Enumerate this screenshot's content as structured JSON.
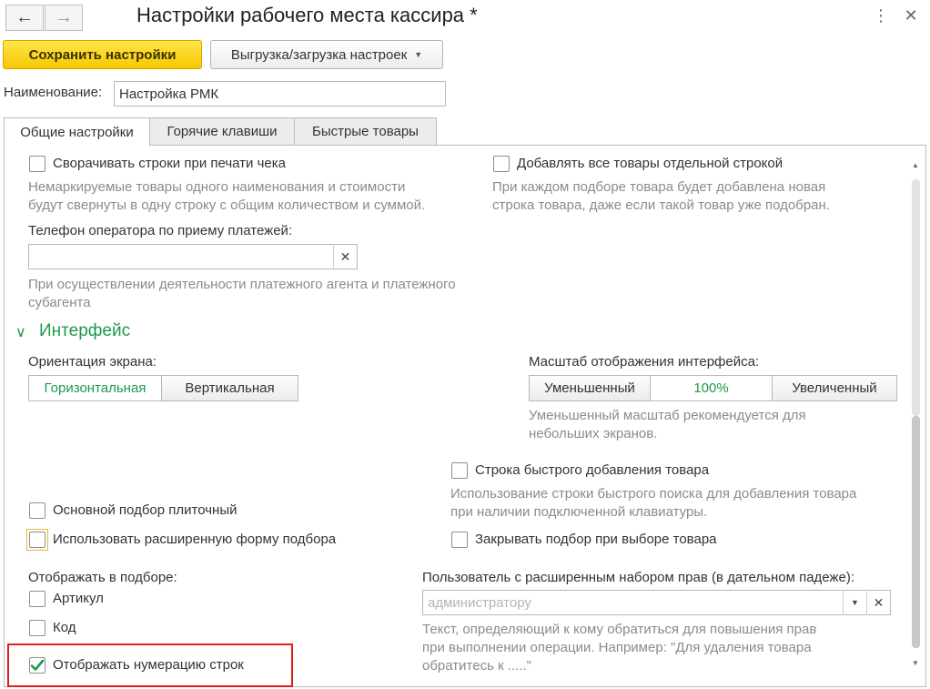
{
  "window": {
    "title": "Настройки рабочего места кассира *",
    "back_icon": "arrow-left-icon",
    "forward_icon": "arrow-right-icon",
    "more_icon": "vertical-dots-icon",
    "close_icon": "close-icon"
  },
  "toolbar": {
    "save_label": "Сохранить настройки",
    "export_label": "Выгрузка/загрузка настроек"
  },
  "name_field": {
    "label": "Наименование:",
    "value": "Настройка РМК"
  },
  "tabs": [
    {
      "label": "Общие настройки",
      "active": true
    },
    {
      "label": "Горячие клавиши",
      "active": false
    },
    {
      "label": "Быстрые товары",
      "active": false
    }
  ],
  "general": {
    "collapse_rows": {
      "label": "Сворачивать строки при печати чека",
      "checked": false,
      "hint_line1": "Немаркируемые товары одного наименования и стоимости",
      "hint_line2": "будут свернуты в одну строку с общим количеством и суммой."
    },
    "separate_row": {
      "label": "Добавлять все товары отдельной строкой",
      "checked": false,
      "hint_line1": "При каждом подборе товара будет добавлена новая",
      "hint_line2": "строка товара, даже если такой товар уже подобран."
    },
    "operator_phone": {
      "label": "Телефон оператора по приему платежей:",
      "value": "",
      "hint_line1": "При осуществлении деятельности платежного агента и платежного",
      "hint_line2": "субагента"
    }
  },
  "interface": {
    "section_title": "Интерфейс",
    "orientation": {
      "label": "Ориентация экрана:",
      "options": [
        "Горизонтальная",
        "Вертикальная"
      ],
      "selected": "Горизонтальная"
    },
    "scale": {
      "label": "Масштаб отображения интерфейса:",
      "options": [
        "Уменьшенный",
        "100%",
        "Увеличенный"
      ],
      "selected": "100%",
      "hint_line1": "Уменьшенный масштаб рекомендуется для",
      "hint_line2": "небольших экранов."
    },
    "quick_add_row": {
      "label": "Строка быстрого добавления товара",
      "checked": false,
      "hint_line1": "Использование строки быстрого поиска для добавления товара",
      "hint_line2": "при наличии подключенной клавиатуры."
    },
    "tile_selection": {
      "label": "Основной подбор плиточный",
      "checked": false
    },
    "extended_form": {
      "label": "Использовать расширенную форму подбора",
      "checked": false
    },
    "close_selection": {
      "label": "Закрывать подбор при выборе товара",
      "checked": false
    },
    "display_in_selection": {
      "label": "Отображать в подборе:",
      "article": {
        "label": "Артикул",
        "checked": false
      },
      "code": {
        "label": "Код",
        "checked": false
      }
    },
    "user_rights": {
      "label": "Пользователь с расширенным набором прав (в дательном падеже):",
      "placeholder": "администратору",
      "hint_line1": "Текст, определяющий к кому обратиться для повышения прав",
      "hint_line2": "при выполнении операции. Например: \"Для удаления товара",
      "hint_line3": "обратитесь к .....\""
    },
    "row_numbering": {
      "label": "Отображать нумерацию строк",
      "checked": true
    }
  },
  "colors": {
    "accent_green": "#1c9a4a",
    "primary_yellow": "#f6c800",
    "highlight_red": "#e01d1d"
  }
}
